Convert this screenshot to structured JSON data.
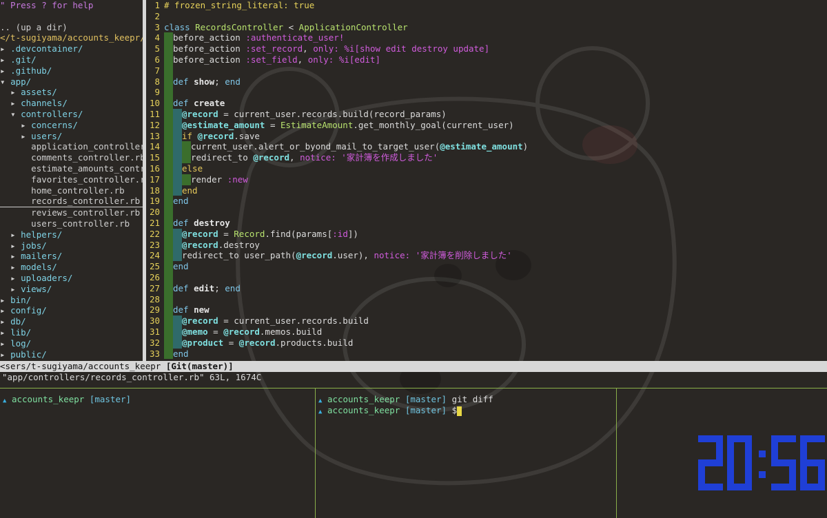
{
  "nerdtree": {
    "help": "\" Press ? for help",
    "items": [
      {
        "text": "",
        "kind": "blank"
      },
      {
        "text": ".. (up a dir)",
        "kind": "file"
      },
      {
        "text": "</t-sugiyama/accounts_keepr/",
        "kind": "root"
      },
      {
        "arrow": "▸",
        "indent": 0,
        "text": ".devcontainer/",
        "kind": "dir"
      },
      {
        "arrow": "▸",
        "indent": 0,
        "text": ".git/",
        "kind": "dir"
      },
      {
        "arrow": "▸",
        "indent": 0,
        "text": ".github/",
        "kind": "dir"
      },
      {
        "arrow": "▾",
        "indent": 0,
        "text": "app/",
        "kind": "dir"
      },
      {
        "arrow": "▸",
        "indent": 1,
        "text": "assets/",
        "kind": "dir"
      },
      {
        "arrow": "▸",
        "indent": 1,
        "text": "channels/",
        "kind": "dir"
      },
      {
        "arrow": "▾",
        "indent": 1,
        "text": "controllers/",
        "kind": "dir"
      },
      {
        "arrow": "▸",
        "indent": 2,
        "text": "concerns/",
        "kind": "dir"
      },
      {
        "arrow": "▸",
        "indent": 2,
        "text": "users/",
        "kind": "dir"
      },
      {
        "arrow": "",
        "indent": 2,
        "text": "application_controller.rb",
        "kind": "file"
      },
      {
        "arrow": "",
        "indent": 2,
        "text": "comments_controller.rb",
        "kind": "file"
      },
      {
        "arrow": "",
        "indent": 2,
        "text": "estimate_amounts_controll",
        "kind": "file"
      },
      {
        "arrow": "",
        "indent": 2,
        "text": "favorites_controller.rb",
        "kind": "file"
      },
      {
        "arrow": "",
        "indent": 2,
        "text": "home_controller.rb",
        "kind": "file"
      },
      {
        "arrow": "",
        "indent": 2,
        "text": "records_controller.rb",
        "kind": "file",
        "cursor": true
      },
      {
        "arrow": "",
        "indent": 2,
        "text": "reviews_controller.rb",
        "kind": "file"
      },
      {
        "arrow": "",
        "indent": 2,
        "text": "users_controller.rb",
        "kind": "file"
      },
      {
        "arrow": "▸",
        "indent": 1,
        "text": "helpers/",
        "kind": "dir"
      },
      {
        "arrow": "▸",
        "indent": 1,
        "text": "jobs/",
        "kind": "dir"
      },
      {
        "arrow": "▸",
        "indent": 1,
        "text": "mailers/",
        "kind": "dir"
      },
      {
        "arrow": "▸",
        "indent": 1,
        "text": "models/",
        "kind": "dir"
      },
      {
        "arrow": "▸",
        "indent": 1,
        "text": "uploaders/",
        "kind": "dir"
      },
      {
        "arrow": "▸",
        "indent": 1,
        "text": "views/",
        "kind": "dir"
      },
      {
        "arrow": "▸",
        "indent": 0,
        "text": "bin/",
        "kind": "dir"
      },
      {
        "arrow": "▸",
        "indent": 0,
        "text": "config/",
        "kind": "dir"
      },
      {
        "arrow": "▸",
        "indent": 0,
        "text": "db/",
        "kind": "dir"
      },
      {
        "arrow": "▸",
        "indent": 0,
        "text": "lib/",
        "kind": "dir"
      },
      {
        "arrow": "▸",
        "indent": 0,
        "text": "log/",
        "kind": "dir"
      },
      {
        "arrow": "▸",
        "indent": 0,
        "text": "public/",
        "kind": "dir"
      }
    ]
  },
  "editor": {
    "lines": [
      {
        "n": "1",
        "ind": [],
        "t": [
          [
            "cmt",
            "# frozen_string_literal: true"
          ]
        ]
      },
      {
        "n": "2",
        "ind": [],
        "t": []
      },
      {
        "n": "3",
        "ind": [],
        "t": [
          [
            "k",
            "class "
          ],
          [
            "cls",
            "RecordsController"
          ],
          [
            "code",
            " < "
          ],
          [
            "cls",
            "ApplicationController"
          ]
        ]
      },
      {
        "n": "4",
        "ind": [
          1
        ],
        "t": [
          [
            "code",
            "before_action "
          ],
          [
            "sym",
            ":authenticate_user!"
          ]
        ]
      },
      {
        "n": "5",
        "ind": [
          1
        ],
        "t": [
          [
            "code",
            "before_action "
          ],
          [
            "sym",
            ":set_record"
          ],
          [
            "code",
            ", "
          ],
          [
            "sym",
            "only:"
          ],
          [
            "code",
            " "
          ],
          [
            "str",
            "%i[show edit destroy update]"
          ]
        ]
      },
      {
        "n": "6",
        "ind": [
          1
        ],
        "t": [
          [
            "code",
            "before_action "
          ],
          [
            "sym",
            ":set_field"
          ],
          [
            "code",
            ", "
          ],
          [
            "sym",
            "only:"
          ],
          [
            "code",
            " "
          ],
          [
            "str",
            "%i[edit]"
          ]
        ]
      },
      {
        "n": "7",
        "ind": [
          1
        ],
        "t": []
      },
      {
        "n": "8",
        "ind": [
          1
        ],
        "t": [
          [
            "k",
            "def "
          ],
          [
            "fn",
            "show"
          ],
          [
            "code",
            "; "
          ],
          [
            "k",
            "end"
          ]
        ]
      },
      {
        "n": "9",
        "ind": [
          1
        ],
        "t": []
      },
      {
        "n": "10",
        "ind": [
          1
        ],
        "t": [
          [
            "k",
            "def "
          ],
          [
            "fn",
            "create"
          ]
        ]
      },
      {
        "n": "11",
        "ind": [
          1,
          2
        ],
        "t": [
          [
            "ivar",
            "@record"
          ],
          [
            "code",
            " = current_user.records.build(record_params)"
          ]
        ]
      },
      {
        "n": "12",
        "ind": [
          1,
          2
        ],
        "t": [
          [
            "ivar",
            "@estimate_amount"
          ],
          [
            "code",
            " = "
          ],
          [
            "cls",
            "EstimateAmount"
          ],
          [
            "code",
            ".get_monthly_goal(current_user)"
          ]
        ]
      },
      {
        "n": "13",
        "ind": [
          1,
          2
        ],
        "t": [
          [
            "kc",
            "if "
          ],
          [
            "ivar",
            "@record"
          ],
          [
            "code",
            ".save"
          ]
        ]
      },
      {
        "n": "14",
        "ind": [
          1,
          2,
          3
        ],
        "t": [
          [
            "code",
            "current_user.alert_or_byond_mail_to_target_user("
          ],
          [
            "ivar",
            "@estimate_amount"
          ],
          [
            "code",
            ")"
          ]
        ]
      },
      {
        "n": "15",
        "ind": [
          1,
          2,
          3
        ],
        "t": [
          [
            "code",
            "redirect_to "
          ],
          [
            "ivar",
            "@record"
          ],
          [
            "code",
            ", "
          ],
          [
            "sym",
            "notice:"
          ],
          [
            "code",
            " "
          ],
          [
            "str",
            "'家計簿を作成しました'"
          ]
        ]
      },
      {
        "n": "16",
        "ind": [
          1,
          2
        ],
        "t": [
          [
            "kc",
            "else"
          ]
        ]
      },
      {
        "n": "17",
        "ind": [
          1,
          2,
          3
        ],
        "t": [
          [
            "code",
            "render "
          ],
          [
            "sym",
            ":new"
          ]
        ]
      },
      {
        "n": "18",
        "ind": [
          1,
          2
        ],
        "t": [
          [
            "kc",
            "end"
          ]
        ]
      },
      {
        "n": "19",
        "ind": [
          1
        ],
        "t": [
          [
            "k",
            "end"
          ]
        ]
      },
      {
        "n": "20",
        "ind": [
          1
        ],
        "t": []
      },
      {
        "n": "21",
        "ind": [
          1
        ],
        "t": [
          [
            "k",
            "def "
          ],
          [
            "fn",
            "destroy"
          ]
        ]
      },
      {
        "n": "22",
        "ind": [
          1,
          2
        ],
        "t": [
          [
            "ivar",
            "@record"
          ],
          [
            "code",
            " = "
          ],
          [
            "cls",
            "Record"
          ],
          [
            "code",
            ".find(params["
          ],
          [
            "sym",
            ":id"
          ],
          [
            "code",
            "])"
          ]
        ]
      },
      {
        "n": "23",
        "ind": [
          1,
          2
        ],
        "t": [
          [
            "ivar",
            "@record"
          ],
          [
            "code",
            ".destroy"
          ]
        ]
      },
      {
        "n": "24",
        "ind": [
          1,
          2
        ],
        "t": [
          [
            "code",
            "redirect_to user_path("
          ],
          [
            "ivar",
            "@record"
          ],
          [
            "code",
            ".user), "
          ],
          [
            "sym",
            "notice:"
          ],
          [
            "code",
            " "
          ],
          [
            "str",
            "'家計簿を削除しました'"
          ]
        ]
      },
      {
        "n": "25",
        "ind": [
          1
        ],
        "t": [
          [
            "k",
            "end"
          ]
        ]
      },
      {
        "n": "26",
        "ind": [
          1
        ],
        "t": []
      },
      {
        "n": "27",
        "ind": [
          1
        ],
        "t": [
          [
            "k",
            "def "
          ],
          [
            "fn",
            "edit"
          ],
          [
            "code",
            "; "
          ],
          [
            "k",
            "end"
          ]
        ]
      },
      {
        "n": "28",
        "ind": [
          1
        ],
        "t": []
      },
      {
        "n": "29",
        "ind": [
          1
        ],
        "t": [
          [
            "k",
            "def "
          ],
          [
            "fn",
            "new"
          ]
        ]
      },
      {
        "n": "30",
        "ind": [
          1,
          2
        ],
        "t": [
          [
            "ivar",
            "@record"
          ],
          [
            "code",
            " = current_user.records.build"
          ]
        ]
      },
      {
        "n": "31",
        "ind": [
          1,
          2
        ],
        "t": [
          [
            "ivar",
            "@memo"
          ],
          [
            "code",
            " = "
          ],
          [
            "ivar",
            "@record"
          ],
          [
            "code",
            ".memos.build"
          ]
        ]
      },
      {
        "n": "32",
        "ind": [
          1,
          2
        ],
        "t": [
          [
            "ivar",
            "@product"
          ],
          [
            "code",
            " = "
          ],
          [
            "ivar",
            "@record"
          ],
          [
            "code",
            ".products.build"
          ]
        ]
      },
      {
        "n": "33",
        "ind": [
          1
        ],
        "t": [
          [
            "k",
            "end"
          ]
        ]
      }
    ]
  },
  "statusline": {
    "path": "<sers/t-sugiyama/accounts_keepr ",
    "git": "[Git(master)]"
  },
  "cmdline": "\"app/controllers/records_controller.rb\" 63L, 1674C",
  "terminal": {
    "pane1": {
      "dir": "accounts_keepr",
      "branch": "[master]"
    },
    "pane2": [
      {
        "dir": "accounts_keepr",
        "branch": "[master]",
        "cmd": " git diff"
      },
      {
        "dir": "accounts_keepr",
        "branch": "[master]",
        "cmd": " $"
      }
    ]
  },
  "clock": {
    "time": "20:56",
    "color": "#1f3fd6"
  },
  "colors": {
    "tmux_border": "#8ab04a",
    "line_numbers": "#e6d15a"
  }
}
